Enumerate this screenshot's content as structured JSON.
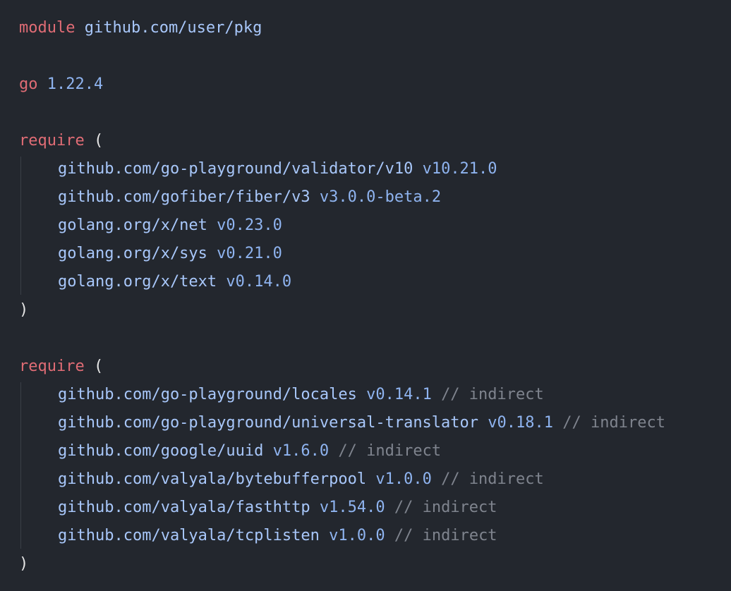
{
  "module_block": {
    "keyword": "module",
    "path": "github.com/user/pkg"
  },
  "go_block": {
    "keyword": "go",
    "version": "1.22.4"
  },
  "require_direct": {
    "keyword": "require",
    "open": "(",
    "close": ")",
    "deps": [
      {
        "path": "github.com/go-playground/validator/v10",
        "version": "v10.21.0"
      },
      {
        "path": "github.com/gofiber/fiber/v3",
        "version": "v3.0.0-beta.2"
      },
      {
        "path": "golang.org/x/net",
        "version": "v0.23.0"
      },
      {
        "path": "golang.org/x/sys",
        "version": "v0.21.0"
      },
      {
        "path": "golang.org/x/text",
        "version": "v0.14.0"
      }
    ]
  },
  "require_indirect": {
    "keyword": "require",
    "open": "(",
    "close": ")",
    "deps": [
      {
        "path": "github.com/go-playground/locales",
        "version": "v0.14.1",
        "comment": "// indirect"
      },
      {
        "path": "github.com/go-playground/universal-translator",
        "version": "v0.18.1",
        "comment": "// indirect"
      },
      {
        "path": "github.com/google/uuid",
        "version": "v1.6.0",
        "comment": "// indirect"
      },
      {
        "path": "github.com/valyala/bytebufferpool",
        "version": "v1.0.0",
        "comment": "// indirect"
      },
      {
        "path": "github.com/valyala/fasthttp",
        "version": "v1.54.0",
        "comment": "// indirect"
      },
      {
        "path": "github.com/valyala/tcplisten",
        "version": "v1.0.0",
        "comment": "// indirect"
      }
    ]
  },
  "colors": {
    "background": "#23272e",
    "keyword": "#e06c75",
    "identifier": "#a8c7fa",
    "comment": "#7f848e"
  }
}
